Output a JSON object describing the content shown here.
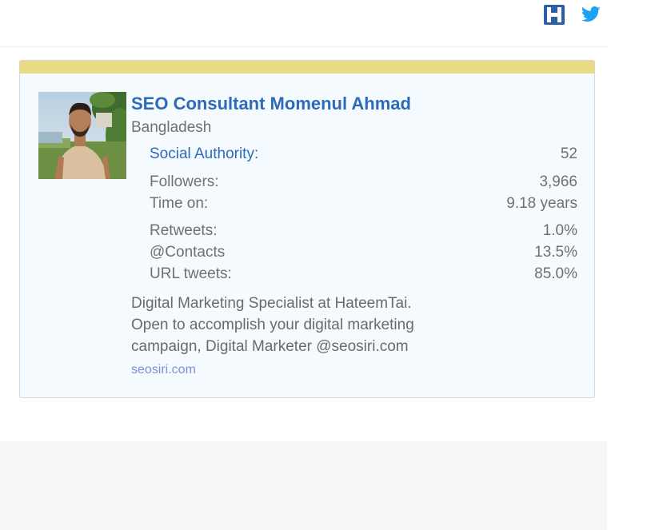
{
  "header": {
    "icons": [
      "hateem-h-icon",
      "twitter-bird-icon"
    ],
    "twitter_color": "#1da1f2",
    "h_icon_color": "#2d5fa8"
  },
  "profile": {
    "name": "SEO Consultant Momenul Ahmad",
    "location": "Bangladesh",
    "stats": {
      "social_authority": {
        "label": "Social Authority:",
        "value": "52"
      },
      "followers": {
        "label": "Followers:",
        "value": "3,966"
      },
      "time_on": {
        "label": "Time on:",
        "value": "9.18 years"
      },
      "retweets": {
        "label": "Retweets:",
        "value": "1.0%"
      },
      "contacts": {
        "label": "@Contacts",
        "value": "13.5%"
      },
      "url_tweets": {
        "label": "URL tweets:",
        "value": "85.0%"
      }
    },
    "bio_lines": [
      "Digital Marketing Specialist at HateemTai.",
      "Open to accomplish your digital marketing",
      "campaign, Digital Marketer @seosiri.com"
    ],
    "link": "seosiri.com"
  },
  "colors": {
    "accent_blue": "#2d6bb8",
    "card_stripe": "#e8dc84",
    "card_background": "#f5fafe",
    "link": "#7a8fd6"
  }
}
